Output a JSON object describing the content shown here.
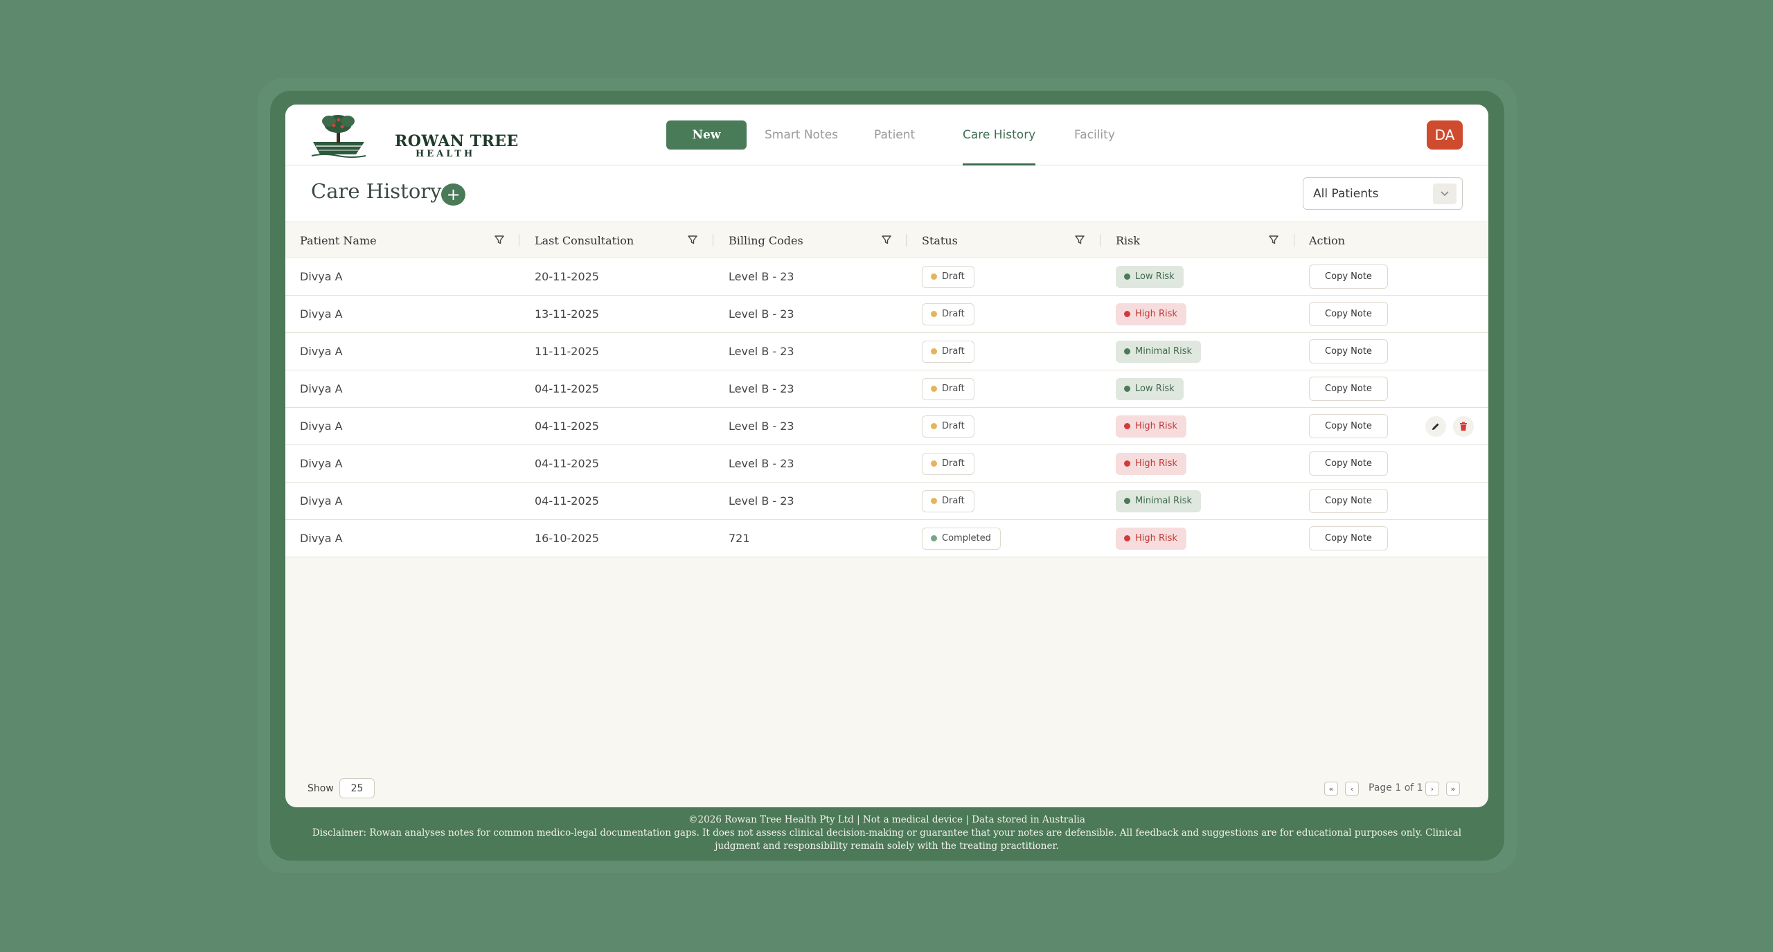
{
  "app": {
    "brand_line1": "ROWAN TREE",
    "brand_line2": "HEALTH",
    "user_initials": "DA"
  },
  "nav": {
    "new": "New",
    "items": [
      "Smart Notes",
      "Patient",
      "Care History",
      "Facility"
    ],
    "active": "Care History"
  },
  "page": {
    "title": "Care History",
    "add_symbol": "+",
    "patient_filter": "All Patients"
  },
  "table": {
    "headers": [
      "Patient Name",
      "Last Consultation",
      "Billing Codes",
      "Status",
      "Risk",
      "Action"
    ],
    "rows": [
      {
        "patient": "Divya A",
        "date": "20-11-2025",
        "billing": "Level B - 23",
        "status": "Draft",
        "risk": "Low Risk",
        "action": "Copy Note"
      },
      {
        "patient": "Divya A",
        "date": "13-11-2025",
        "billing": "Level B - 23",
        "status": "Draft",
        "risk": "High Risk",
        "action": "Copy Note"
      },
      {
        "patient": "Divya A",
        "date": "11-11-2025",
        "billing": "Level B - 23",
        "status": "Draft",
        "risk": "Minimal Risk",
        "action": "Copy Note"
      },
      {
        "patient": "Divya A",
        "date": "04-11-2025",
        "billing": "Level B - 23",
        "status": "Draft",
        "risk": "Low Risk",
        "action": "Copy Note"
      },
      {
        "patient": "Divya A",
        "date": "04-11-2025",
        "billing": "Level B - 23",
        "status": "Draft",
        "risk": "High Risk",
        "action": "Copy Note"
      },
      {
        "patient": "Divya A",
        "date": "04-11-2025",
        "billing": "Level B - 23",
        "status": "Draft",
        "risk": "High Risk",
        "action": "Copy Note"
      },
      {
        "patient": "Divya A",
        "date": "04-11-2025",
        "billing": "Level B - 23",
        "status": "Draft",
        "risk": "Minimal Risk",
        "action": "Copy Note"
      },
      {
        "patient": "Divya A",
        "date": "16-10-2025",
        "billing": "721",
        "status": "Completed",
        "risk": "High Risk",
        "action": "Copy Note"
      }
    ],
    "hovered_row": 5
  },
  "pagination": {
    "show_label": "Show",
    "page_size": "25",
    "page_info": "Page 1 of 1"
  },
  "footer": {
    "line1": "©2026 Rowan Tree Health Pty Ltd | Not a medical device | Data stored in Australia",
    "line2": "Disclaimer: Rowan analyses notes for common medico-legal documentation gaps. It does not assess clinical decision-making or guarantee that your notes are defensible. All feedback and suggestions are for educational purposes only. Clinical judgment and responsibility remain solely with the treating practitioner."
  },
  "colors": {
    "background": "#5e896c",
    "brand_green": "#4a7b58",
    "avatar": "#cf4b2e",
    "draft_dot": "#e6b45a",
    "completed_dot": "#7aa486",
    "low_risk_dot": "#4a7b58",
    "high_risk_dot": "#d23a3a"
  }
}
